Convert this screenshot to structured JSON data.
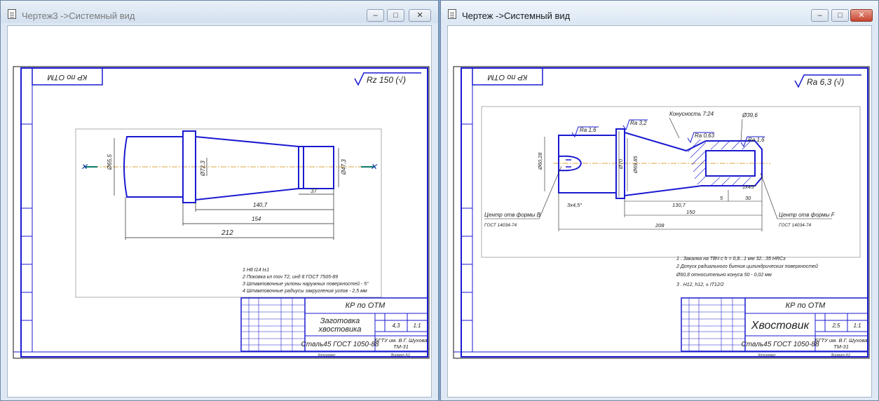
{
  "left_window": {
    "title": "Чертеж3 ->Системный вид",
    "active": false,
    "controls": {
      "minimize": "–",
      "maximize": "□",
      "close": "✕"
    },
    "drawing": {
      "stamp_text": "КР по ОТМ",
      "roughness": "Rz 150 (√)",
      "dims": {
        "d_left": "Ø65,5",
        "d_cone": "Ø72,3",
        "d_right": "Ø47,3",
        "l1": "37",
        "l2": "140,7",
        "l3": "154",
        "l4": "212"
      },
      "notes": [
        "1  Н8 t14 t±1",
        "2  Поковка кл точ Т2, инд 8 ГОСТ 7505-89",
        "3  Штамповочные уклоны наружных поверхностей - 5°",
        "4  Штамповочные радиусы закругления углов - 2,5 мм"
      ],
      "title_block": {
        "header": "КР по ОТМ",
        "part_name_1": "Заготовка",
        "part_name_2": "хвостовика",
        "material": "Сталь45 ГОСТ 1050-88",
        "mass": "4,3",
        "scale": "1:1",
        "org": "БГТУ им. В.Г. Шухова",
        "group": "ТМ-31",
        "copied": "Копировал",
        "format": "Формат  А3"
      }
    }
  },
  "right_window": {
    "title": "Чертеж ->Системный вид",
    "active": true,
    "controls": {
      "minimize": "–",
      "maximize": "□",
      "close": "✕"
    },
    "drawing": {
      "stamp_text": "КР по ОТМ",
      "roughness": "Ra 6,3 (√)",
      "callouts": {
        "ra16_a": "Ra 1,6",
        "ra32": "Ra 3,2",
        "ra063": "Ra 0,63",
        "ra16_b": "Ra 1,6",
        "taper": "Конусность 7:24",
        "bore": "Ø39,6",
        "center_left_1": "Центр отв формы В",
        "center_left_2": "ГОСТ 14034-74",
        "center_right_1": "Центр отв формы F",
        "center_right_2": "ГОСТ 14034-74"
      },
      "dims": {
        "d1": "Ø60,28",
        "d2": "Ø70",
        "d3": "Ø69,85",
        "ch1": "3х4,5°",
        "ch2": "1х45°",
        "l_taper": "130,7",
        "l_5": "5",
        "l_30": "30",
        "l_150": "150",
        "l_208": "208"
      },
      "notes": [
        "1 . Закалка на ТВЧ с h = 0,8...1 мм 32...35 HRCэ",
        "2   Допуск радиального биения цилиндрических поверхностей",
        "Ø60,8 относительно конуса 50 - 0,02 мм",
        "3 . Н12, h12, ± IT12/2"
      ],
      "title_block": {
        "header": "КР по ОТМ",
        "part_name_1": "Хвостовик",
        "part_name_2": "",
        "material": "Сталь45 ГОСТ 1050-88",
        "mass": "2,5",
        "scale": "1:1",
        "org": "БГТУ им. В.Г. Шухова",
        "group": "ТМ-31",
        "copied": "Копировал",
        "format": "Формат  А3"
      }
    }
  }
}
